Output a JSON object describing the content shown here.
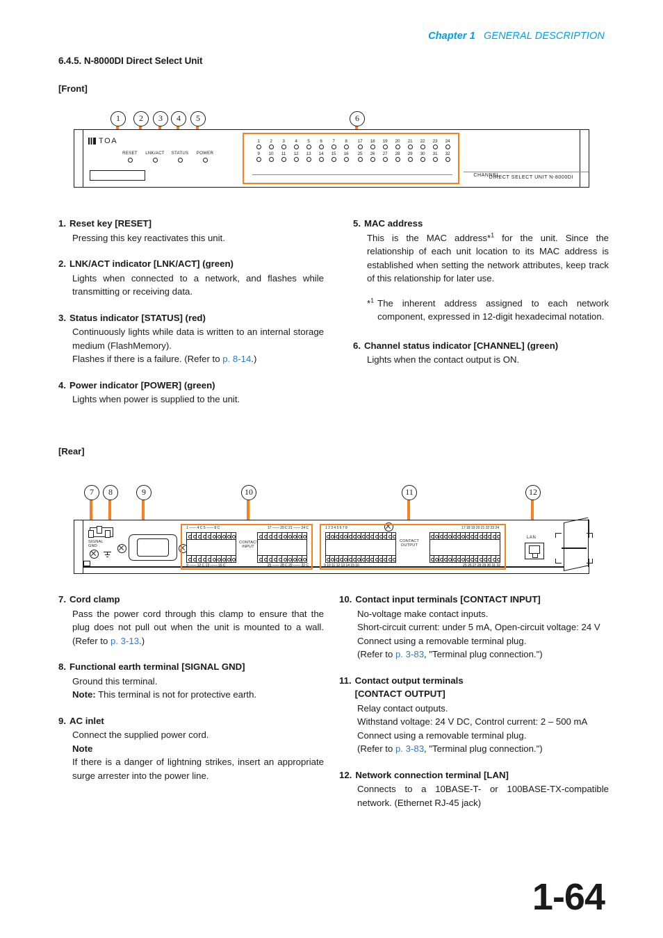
{
  "header": {
    "chapter": "Chapter 1",
    "title": "GENERAL DESCRIPTION"
  },
  "section": {
    "title": "6.4.5. N-8000DI Direct Select Unit"
  },
  "views": {
    "front": "[Front]",
    "rear": "[Rear]"
  },
  "front_panel": {
    "brand": "TOA",
    "indicators": [
      "RESET",
      "LNK/ACT",
      "STATUS",
      "POWER"
    ],
    "channel_word": "CHANNEL",
    "model_text": "DIRECT SELECT UNIT N-8000DI",
    "channel_numbers_left_top": [
      "1",
      "2",
      "3",
      "4",
      "5",
      "6",
      "7",
      "8"
    ],
    "channel_numbers_left_bottom": [
      "9",
      "10",
      "11",
      "12",
      "13",
      "14",
      "15",
      "16"
    ],
    "channel_numbers_right_top": [
      "17",
      "18",
      "19",
      "20",
      "21",
      "22",
      "23",
      "24"
    ],
    "channel_numbers_right_bottom": [
      "25",
      "26",
      "27",
      "28",
      "29",
      "30",
      "31",
      "32"
    ],
    "callouts": [
      "1",
      "2",
      "3",
      "4",
      "5",
      "6"
    ]
  },
  "rear_panel": {
    "signal_gnd": "SIGNAL\nGND",
    "lan_label": "LAN",
    "contact_input_label": "CONTACT\nINPUT",
    "contact_output_label": "CONTACT\nOUTPUT",
    "input_caption_1": "1 —— 4 C 5 —— 8 C",
    "input_caption_2": "9 —— 12 C 13 —— 16 C",
    "input_caption_3": "17 —— 20 C 21 —— 24 C",
    "input_caption_4": "25 —— 28 C 29 —— 32 C",
    "output_numbers_block1_top": [
      "1",
      "2",
      "3",
      "4",
      "5",
      "6",
      "7",
      "8"
    ],
    "output_numbers_block1_bottom": [
      "9",
      "10",
      "11",
      "12",
      "13",
      "14",
      "15",
      "16"
    ],
    "output_numbers_block2_top": [
      "17",
      "18",
      "19",
      "20",
      "21",
      "22",
      "23",
      "24"
    ],
    "output_numbers_block2_bottom": [
      "25",
      "26",
      "27",
      "28",
      "29",
      "30",
      "31",
      "32"
    ],
    "callouts": [
      "7",
      "8",
      "9",
      "10",
      "11",
      "12"
    ]
  },
  "items": {
    "i1": {
      "num": "1.",
      "title": "Reset key [RESET]",
      "body": "Pressing this key reactivates this unit."
    },
    "i2": {
      "num": "2.",
      "title": "LNK/ACT indicator [LNK/ACT] (green)",
      "body": "Lights when connected to a network, and flashes while transmitting or receiving data."
    },
    "i3": {
      "num": "3.",
      "title": "Status indicator [STATUS] (red)",
      "body_l1": "Continuously lights while data is written to an internal storage medium (FlashMemory).",
      "body_l2_pre": "Flashes if there is a failure. (Refer to ",
      "body_l2_link": "p. 8-14",
      "body_l2_post": ".)"
    },
    "i4": {
      "num": "4.",
      "title": "Power indicator [POWER] (green)",
      "body": "Lights when power is supplied to the unit."
    },
    "i5": {
      "num": "5.",
      "title": "MAC address",
      "body_pre": "This is the MAC address*",
      "body_sup": "1",
      "body_post": " for the unit. Since the relationship of each unit location to its MAC address is established when setting the network attributes, keep track of this relationship for later use.",
      "footnote_mark_star": "*",
      "footnote_mark_num": "1",
      "footnote_text": "The inherent address assigned to each network component, expressed in 12-digit hexadecimal notation."
    },
    "i6": {
      "num": "6.",
      "title": "Channel status indicator [CHANNEL] (green)",
      "body": "Lights when the contact output is ON."
    },
    "i7": {
      "num": "7.",
      "title": "Cord clamp",
      "body_pre": "Pass the power cord through this clamp to ensure that the plug does not pull out when the unit is mounted to a wall. (Refer to ",
      "body_link": "p. 3-13",
      "body_post": ".)"
    },
    "i8": {
      "num": "8.",
      "title": "Functional earth terminal [SIGNAL GND]",
      "body_l1": "Ground this terminal.",
      "body_note_label": "Note:",
      "body_note_text": " This terminal is not for protective earth."
    },
    "i9": {
      "num": "9.",
      "title": "AC inlet",
      "body_l1": "Connect the supplied power cord.",
      "body_note_label": "Note",
      "body_l2": "If there is a danger of lightning strikes, insert an appropriate surge arrester into the power line."
    },
    "i10": {
      "num": "10.",
      "title": "Contact input terminals [CONTACT INPUT]",
      "body_l1": "No-voltage make contact inputs.",
      "body_l2": "Short-circuit current: under 5 mA, Open-circuit voltage: 24 V",
      "body_l3": "Connect using a removable terminal plug.",
      "body_l4_pre": "(Refer to ",
      "body_l4_link": "p. 3-83",
      "body_l4_post": ", \"Terminal plug connection.\")"
    },
    "i11": {
      "num": "11.",
      "title_l1": "Contact output terminals",
      "title_l2": "[CONTACT OUTPUT]",
      "body_l1": "Relay contact outputs.",
      "body_l2": "Withstand voltage: 24 V DC, Control current: 2 – 500 mA",
      "body_l3": "Connect using a removable terminal plug.",
      "body_l4_pre": "(Refer to ",
      "body_l4_link": "p. 3-83",
      "body_l4_post": ", \"Terminal plug connection.\")"
    },
    "i12": {
      "num": "12.",
      "title": "Network connection terminal [LAN]",
      "body": "Connects to a 10BASE-T- or 100BASE-TX-compatible network. (Ethernet RJ-45 jack)"
    }
  },
  "page_number": "1-64",
  "colors": {
    "accent_orange": "#f5821f",
    "header_blue": "#00a0e9",
    "link_blue": "#2f79c4"
  }
}
